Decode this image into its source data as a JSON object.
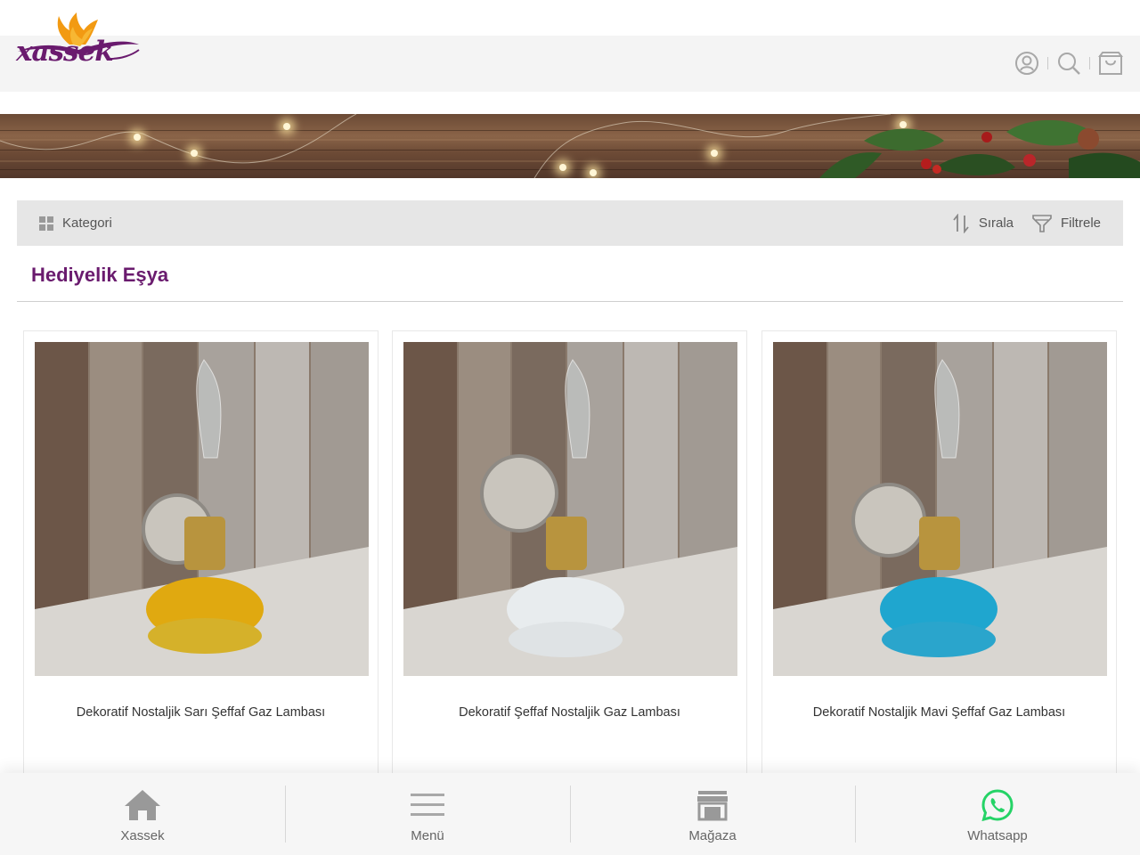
{
  "brand": {
    "logo_text": "xassek",
    "color": "#6a1b6e",
    "flame_color": "#f29a12"
  },
  "header": {
    "icons": [
      "user-icon",
      "search-icon",
      "cart-icon"
    ]
  },
  "toolbar": {
    "category_label": "Kategori",
    "sort_label": "Sırala",
    "filter_label": "Filtrele"
  },
  "page": {
    "title": "Hediyelik Eşya"
  },
  "products": [
    {
      "name": "Dekoratif Nostaljik Sarı Şeffaf Gaz Lambası",
      "glass_color": "#e0a910"
    },
    {
      "name": "Dekoratif Şeffaf Nostaljik Gaz Lambası",
      "glass_color": "#e8ecee"
    },
    {
      "name": "Dekoratif Nostaljik Mavi Şeffaf Gaz Lambası",
      "glass_color": "#1fa6cf"
    }
  ],
  "bottom_nav": [
    {
      "label": "Xassek",
      "icon": "home-icon"
    },
    {
      "label": "Menü",
      "icon": "menu-icon"
    },
    {
      "label": "Mağaza",
      "icon": "store-icon"
    },
    {
      "label": "Whatsapp",
      "icon": "whatsapp-icon",
      "color": "#25d366"
    }
  ]
}
